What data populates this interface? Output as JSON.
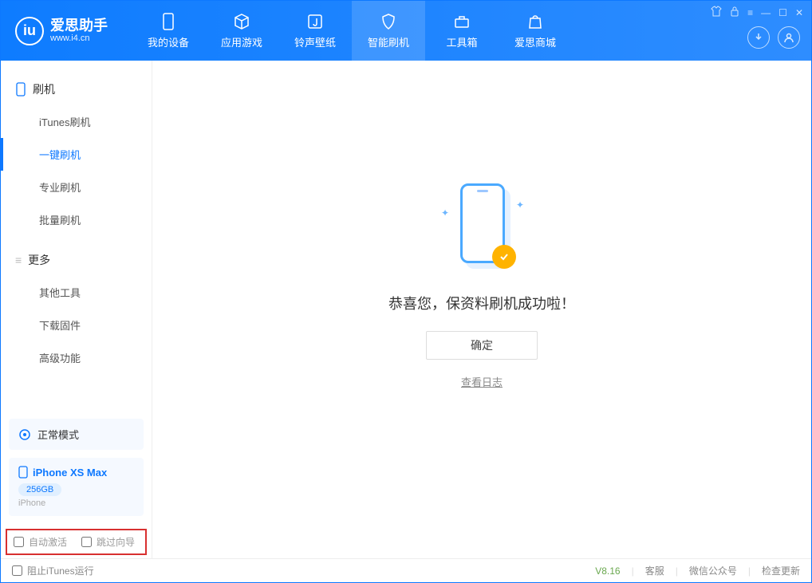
{
  "app": {
    "title": "爱思助手",
    "url": "www.i4.cn"
  },
  "nav": {
    "tabs": [
      {
        "label": "我的设备",
        "icon": "phone"
      },
      {
        "label": "应用游戏",
        "icon": "cube"
      },
      {
        "label": "铃声壁纸",
        "icon": "music"
      },
      {
        "label": "智能刷机",
        "icon": "shield"
      },
      {
        "label": "工具箱",
        "icon": "toolbox"
      },
      {
        "label": "爱思商城",
        "icon": "bag"
      }
    ],
    "active_index": 3
  },
  "sidebar": {
    "section1": {
      "title": "刷机",
      "items": [
        "iTunes刷机",
        "一键刷机",
        "专业刷机",
        "批量刷机"
      ],
      "active_index": 1
    },
    "section2": {
      "title": "更多",
      "items": [
        "其他工具",
        "下载固件",
        "高级功能"
      ]
    }
  },
  "device": {
    "mode": "正常模式",
    "name": "iPhone XS Max",
    "storage": "256GB",
    "type": "iPhone"
  },
  "options": {
    "auto_activate": "自动激活",
    "skip_guide": "跳过向导",
    "block_itunes": "阻止iTunes运行"
  },
  "main": {
    "success_text": "恭喜您，保资料刷机成功啦！",
    "ok_label": "确定",
    "log_link": "查看日志"
  },
  "footer": {
    "version": "V8.16",
    "links": [
      "客服",
      "微信公众号",
      "检查更新"
    ]
  }
}
